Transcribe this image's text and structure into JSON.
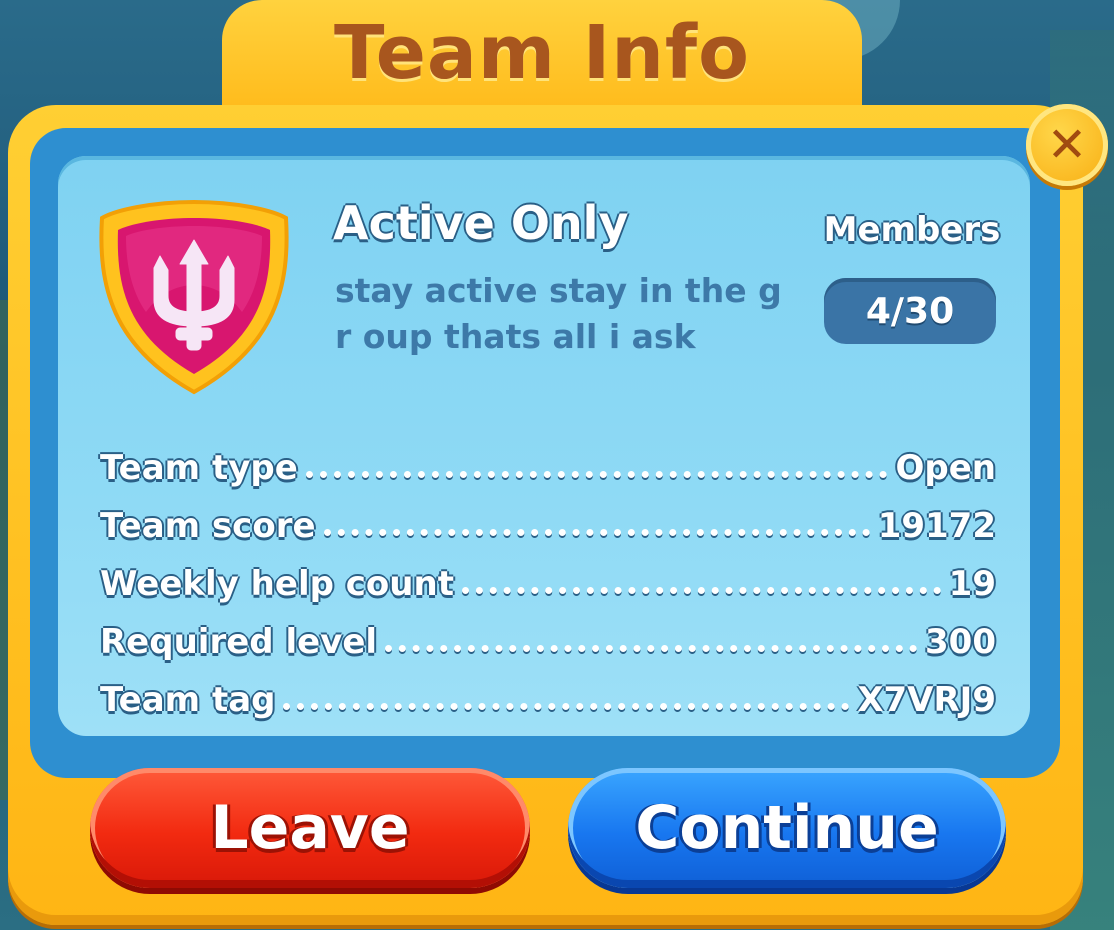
{
  "dialog": {
    "title": "Team Info",
    "close_icon": "close-icon"
  },
  "team": {
    "badge_icon": "trident-shield-icon",
    "badge_color": "#d8166f",
    "name": "Active Only",
    "description": "stay active stay in the gr oup thats all i ask",
    "members_label": "Members",
    "members_count": "4/30"
  },
  "info_rows": [
    {
      "label": "Team type",
      "value": "Open"
    },
    {
      "label": "Team score",
      "value": "19172"
    },
    {
      "label": "Weekly help count",
      "value": "19"
    },
    {
      "label": "Required level",
      "value": "300"
    },
    {
      "label": "Team tag",
      "value": "X7VRJ9"
    }
  ],
  "buttons": {
    "leave_label": "Leave",
    "leave_color": "#f22a10",
    "continue_label": "Continue",
    "continue_color": "#1877f0"
  },
  "theme": {
    "frame_color": "#ffc125",
    "panel_color": "#8fdaf5",
    "title_color": "#a8561e"
  }
}
